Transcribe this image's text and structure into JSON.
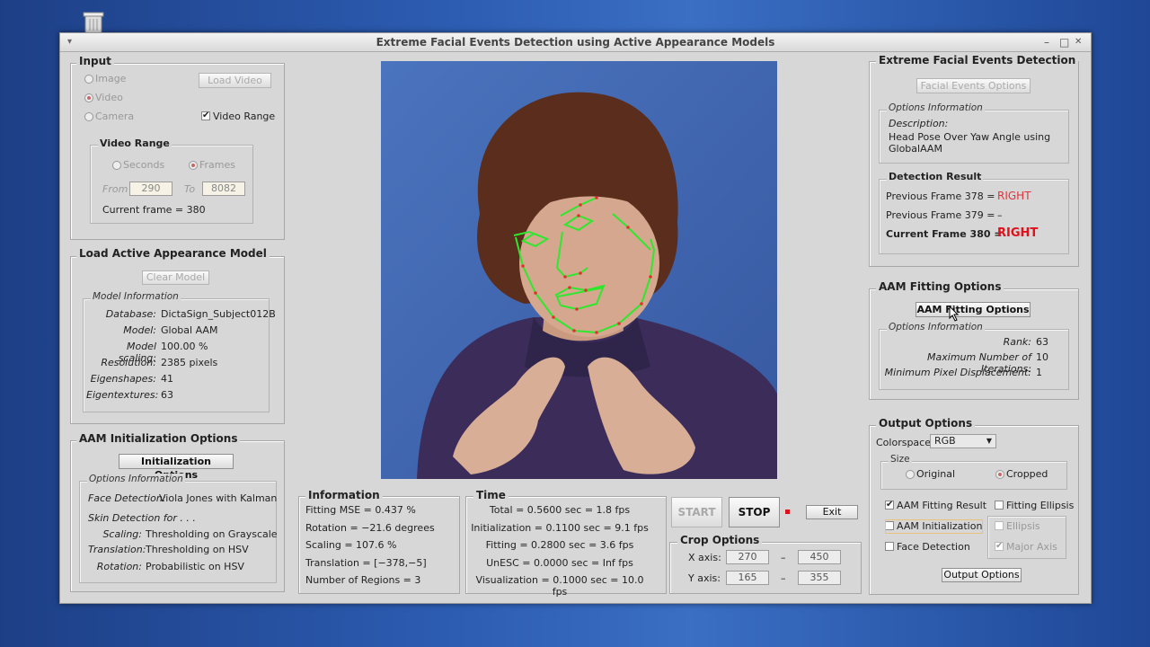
{
  "window": {
    "title": "Extreme Facial Events Detection using Active Appearance Models",
    "menu_glyph": "▾",
    "minimize": "–",
    "maximize": "□",
    "close": "✕"
  },
  "input": {
    "title": "Input",
    "image": "Image",
    "video": "Video",
    "camera": "Camera",
    "load_video": "Load Video",
    "video_range_check": "Video Range",
    "range_title": "Video Range",
    "seconds": "Seconds",
    "frames": "Frames",
    "from_label": "From",
    "from_value": "290",
    "to_label": "To",
    "to_value": "8082",
    "current_frame": "Current frame = 380"
  },
  "aam_model": {
    "title": "Load Active Appearance Model",
    "clear_model": "Clear Model",
    "info_title": "Model Information",
    "rows": [
      {
        "label": "Database:",
        "value": "DictaSign_Subject012B"
      },
      {
        "label": "Model:",
        "value": "Global AAM"
      },
      {
        "label": "Model scaling:",
        "value": "100.00 %"
      },
      {
        "label": "Resolution:",
        "value": "2385 pixels"
      },
      {
        "label": "Eigenshapes:",
        "value": "41"
      },
      {
        "label": "Eigentextures:",
        "value": "63"
      }
    ]
  },
  "init_options": {
    "title": "AAM Initialization Options",
    "button": "Initialization Options",
    "info_title": "Options Information",
    "face_detection_label": "Face Detection:",
    "face_detection_value": "Viola Jones with Kalman",
    "skin_detection": "Skin Detection for . . .",
    "scaling_label": "Scaling:",
    "scaling_value": "Thresholding on Grayscale",
    "translation_label": "Translation:",
    "translation_value": "Thresholding on HSV",
    "rotation_label": "Rotation:",
    "rotation_value": "Probabilistic on HSV"
  },
  "information": {
    "title": "Information",
    "lines": [
      "Fitting MSE = 0.437 %",
      "Rotation = −21.6 degrees",
      "Scaling = 107.6 %",
      "Translation = [−378,−5]",
      "Number of Regions = 3"
    ]
  },
  "time": {
    "title": "Time",
    "lines": [
      "Total = 0.5600 sec = 1.8 fps",
      "Initialization = 0.1100 sec = 9.1 fps",
      "Fitting = 0.2800 sec = 3.6 fps",
      "UnESC = 0.0000 sec = Inf fps",
      "Visualization = 0.1000 sec = 10.0 fps"
    ]
  },
  "controls": {
    "start": "START",
    "stop": "STOP",
    "exit": "Exit"
  },
  "crop": {
    "title": "Crop Options",
    "x_label": "X axis:",
    "x_from": "270",
    "x_to": "450",
    "y_label": "Y axis:",
    "y_from": "165",
    "y_to": "355",
    "dash": "–"
  },
  "efed": {
    "title": "Extreme Facial Events Detection",
    "button": "Facial Events Options",
    "info_title": "Options Information",
    "desc_label": "Description:",
    "desc_line1": "Head Pose Over Yaw Angle using",
    "desc_line2": "GlobalAAM",
    "result_title": "Detection Result",
    "prev1_label": "Previous Frame 378 =",
    "prev1_value": "RIGHT",
    "prev2_label": "Previous Frame 379 =",
    "prev2_value": "–",
    "cur_label": "Current Frame 380 =",
    "cur_value": "RIGHT"
  },
  "fitting": {
    "title": "AAM Fitting Options",
    "button": "AAM Fitting Options",
    "info_title": "Options Information",
    "rows": [
      {
        "label": "Rank:",
        "value": "63"
      },
      {
        "label": "Maximum Number of Iterations:",
        "value": "10"
      },
      {
        "label": "Minimum Pixel Displacement:",
        "value": "1"
      }
    ]
  },
  "output": {
    "title": "Output Options",
    "colorspace_label": "Colorspace:",
    "colorspace_value": "RGB",
    "size_title": "Size",
    "original": "Original",
    "cropped": "Cropped",
    "fitting_result": "AAM Fitting Result",
    "fitting_ellipsis": "Fitting Ellipsis",
    "aam_init": "AAM Initialization",
    "ellipsis": "Ellipsis",
    "face_detection": "Face Detection",
    "major_axis": "Major Axis",
    "button": "Output Options"
  },
  "colors": {
    "window_bg": "#d7d7d7",
    "desktop": "#2d5db3",
    "video_bg": "#3e64ad",
    "landmarks": "#2ee82e",
    "result_red": "#e0101a",
    "stop_indicator": "#e0101a"
  }
}
